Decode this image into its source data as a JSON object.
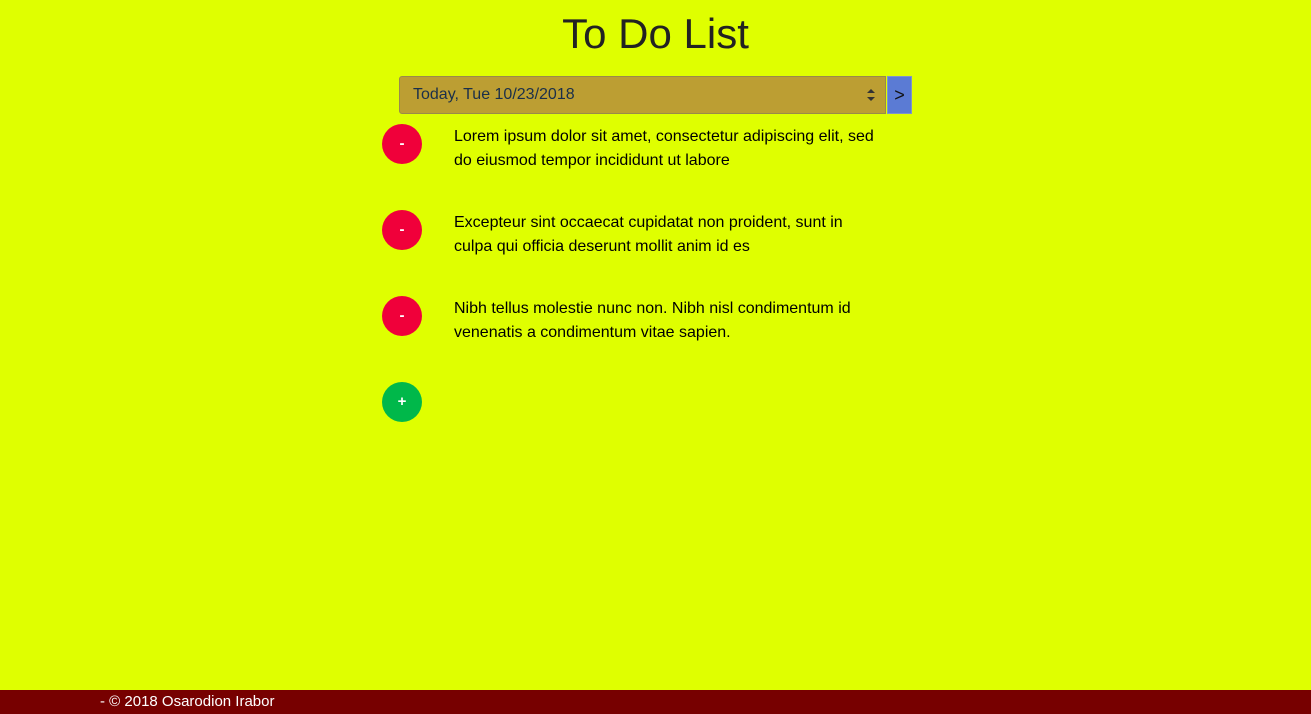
{
  "header": {
    "title": "To Do List"
  },
  "date_selector": {
    "selected": "Today, Tue 10/23/2018",
    "next_label": ">"
  },
  "todos": [
    {
      "text": "Lorem ipsum dolor sit amet, consectetur adipiscing elit, sed do eiusmod tempor incididunt ut labore",
      "remove_label": "-"
    },
    {
      "text": "Excepteur sint occaecat cupidatat non proident, sunt in culpa qui officia deserunt mollit anim id es",
      "remove_label": "-"
    },
    {
      "text": "Nibh tellus molestie nunc non. Nibh nisl condimentum id venenatis a condimentum vitae sapien.",
      "remove_label": "-"
    }
  ],
  "add_label": "+",
  "footer": {
    "text": "- © 2018 Osarodion Irabor"
  },
  "colors": {
    "background": "#DFFF00",
    "select_bg": "#BC9E33",
    "next_button": "#5B7BD4",
    "remove_button": "#F0003A",
    "add_button": "#00B84A",
    "footer_bg": "#770000"
  }
}
